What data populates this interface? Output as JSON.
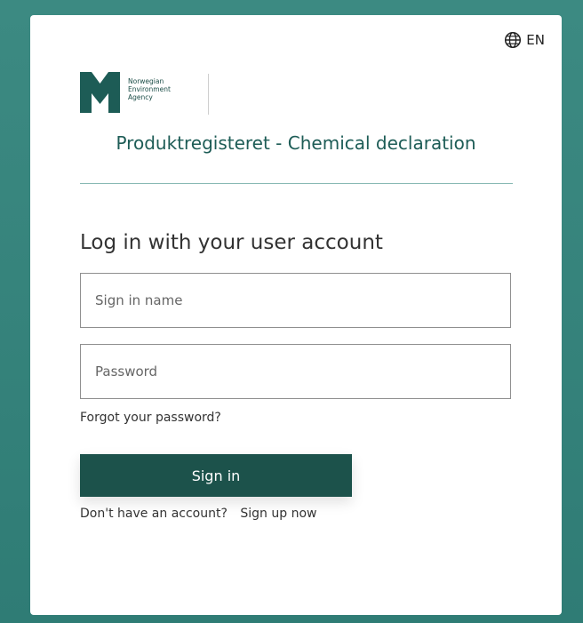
{
  "language": {
    "icon": "globe-icon",
    "label": "EN"
  },
  "logo": {
    "lines": [
      "Norwegian",
      "Environment",
      "Agency"
    ]
  },
  "app_title": "Produktregisteret - Chemical declaration",
  "heading": "Log in with your user account",
  "form": {
    "username_placeholder": "Sign in name",
    "password_placeholder": "Password",
    "forgot_label": "Forgot your password?",
    "signin_label": "Sign in",
    "no_account_label": "Don't have an account?",
    "signup_label": "Sign up now"
  },
  "colors": {
    "brand": "#1c524b",
    "title": "#1d5c56",
    "background": "#2e7d76"
  }
}
